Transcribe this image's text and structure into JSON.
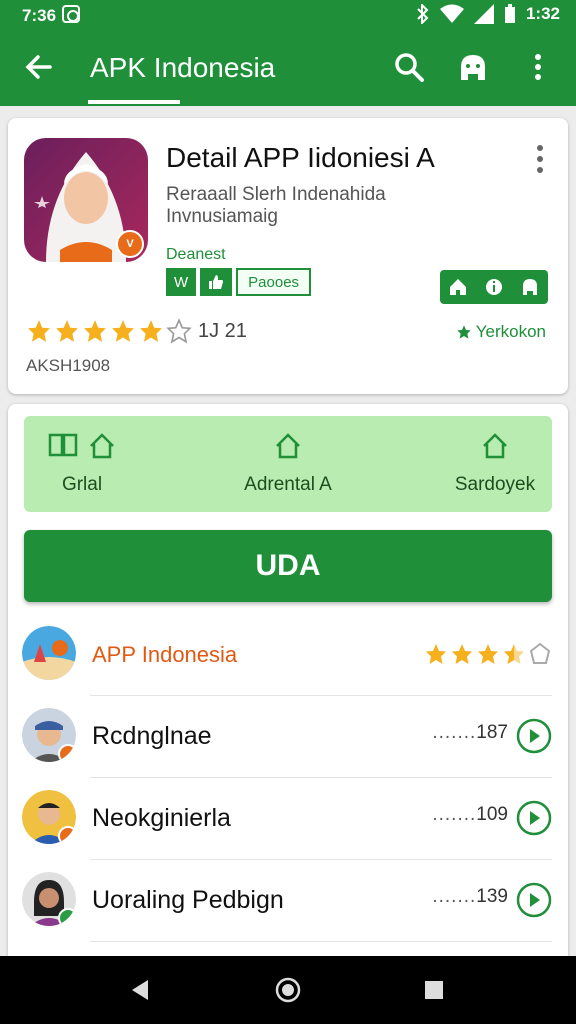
{
  "status": {
    "time": "7:36",
    "right_time": "1:32"
  },
  "appbar": {
    "title": "APK Indonesia"
  },
  "detail": {
    "title": "Detail APP Iidoniesi A",
    "subtitle_line1": "Reraaall Slerh Indenahida",
    "subtitle_line2": "Invnusiamaig",
    "developer": "Deanest",
    "chip_icon_1": "W",
    "chip_label": "Paooes",
    "rating_count": "1J 21",
    "right_rating": "Yerkokon",
    "version": "AKSH1908",
    "icon_badge": "V"
  },
  "features": [
    {
      "label": "Grlal"
    },
    {
      "label": "Adrental A"
    },
    {
      "label": "Sardoyek"
    }
  ],
  "primary_button": {
    "label": "UDA"
  },
  "list": [
    {
      "name": "APP Indonesia",
      "rating": "3.5"
    },
    {
      "name": "Rcdnglnae",
      "count": "187"
    },
    {
      "name": "Neokginierla",
      "count": "109"
    },
    {
      "name": "Uoraling Pedbign",
      "count": "139"
    }
  ],
  "colors": {
    "primary": "#1f8f3a",
    "accent_star": "#f6b01e",
    "highlight": "#b8ecb0"
  }
}
